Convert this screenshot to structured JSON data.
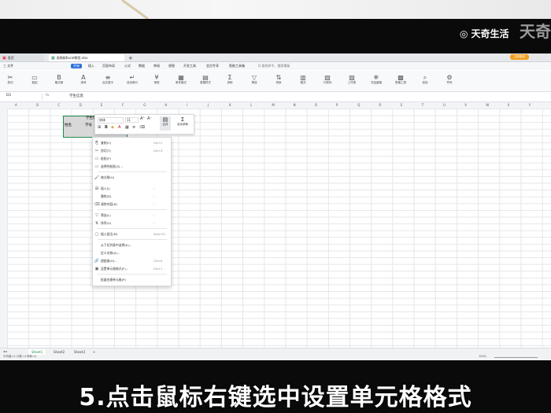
{
  "watermark": {
    "brand": "天奇生活",
    "corner": "天奇"
  },
  "caption": "5.点击鼠标右键选中设置单元格格式",
  "window": {
    "tabs": [
      {
        "label": "首页"
      },
      {
        "label": "表格制Excel教程.xlsx"
      }
    ],
    "new_tab": "+",
    "login": "立即登录"
  },
  "menubar": {
    "items": [
      "三 文件",
      "开始",
      "插入",
      "页面布局",
      "公式",
      "数据",
      "审阅",
      "视图",
      "开发工具",
      "会员专享",
      "智能工具箱"
    ],
    "search": "Q 查找命令、搜索模板"
  },
  "ribbon": {
    "buttons": [
      {
        "icon": "✂",
        "label": "剪切"
      },
      {
        "icon": "▭",
        "label": "粘贴"
      },
      {
        "icon": "B",
        "label": "格式刷"
      },
      {
        "icon": "A",
        "label": "宋体"
      },
      {
        "icon": "≡",
        "label": "合并居中"
      },
      {
        "icon": "↵",
        "label": "自动换行"
      },
      {
        "icon": "¥",
        "label": "常规"
      },
      {
        "icon": "▦",
        "label": "条件格式"
      },
      {
        "icon": "▤",
        "label": "表格样式"
      },
      {
        "icon": "Σ",
        "label": "求和"
      },
      {
        "icon": "▽",
        "label": "筛选"
      },
      {
        "icon": "⇅",
        "label": "排序"
      },
      {
        "icon": "▥",
        "label": "格式"
      },
      {
        "icon": "▧",
        "label": "行和列"
      },
      {
        "icon": "▨",
        "label": "工作表"
      },
      {
        "icon": "❄",
        "label": "冻结窗格"
      },
      {
        "icon": "▩",
        "label": "表格工具"
      },
      {
        "icon": "⌕",
        "label": "查找"
      },
      {
        "icon": "⚙",
        "label": "符号"
      }
    ]
  },
  "formula_bar": {
    "name_box": "D1",
    "fx": "fx",
    "value": "学生信息"
  },
  "columns": [
    "A",
    "B",
    "C",
    "D",
    "E",
    "F",
    "G",
    "H",
    "I",
    "J",
    "K",
    "L",
    "M",
    "N",
    "O",
    "P",
    "Q",
    "R",
    "S",
    "T",
    "U",
    "V",
    "W",
    "X",
    "Y"
  ],
  "cells": {
    "title": "学生信息",
    "name": "姓名",
    "id": "学号"
  },
  "mini_toolbar": {
    "font": "宋体",
    "size": "11",
    "merge": "合并",
    "autosum": "自动求和"
  },
  "context_menu": {
    "items": [
      {
        "icon": "⎘",
        "label": "复制(C)",
        "shortcut": "Ctrl+C"
      },
      {
        "icon": "✂",
        "label": "剪切(T)",
        "shortcut": "Ctrl+X"
      },
      {
        "icon": "▭",
        "label": "粘贴(P)",
        "shortcut": ""
      },
      {
        "icon": "▭",
        "label": "选择性粘贴(S)...",
        "shortcut": ""
      },
      {
        "icon": "🖌",
        "label": "格式刷(O)",
        "shortcut": ""
      },
      {
        "icon": "⊞",
        "label": "插入(I)",
        "shortcut": "›"
      },
      {
        "icon": "",
        "label": "删除(D)",
        "shortcut": "›"
      },
      {
        "icon": "⌫",
        "label": "清除内容(N)",
        "shortcut": "›"
      },
      {
        "icon": "▽",
        "label": "筛选(L)",
        "shortcut": "›"
      },
      {
        "icon": "⇅",
        "label": "排序(U)",
        "shortcut": "›"
      },
      {
        "icon": "▢",
        "label": "插入批注(M)",
        "shortcut": "Shift+F2"
      },
      {
        "icon": "",
        "label": "从下拉列表中选择(K)...",
        "shortcut": ""
      },
      {
        "icon": "",
        "label": "定义名称(A)...",
        "shortcut": ""
      },
      {
        "icon": "🔗",
        "label": "超链接(H)...",
        "shortcut": "Ctrl+K"
      },
      {
        "icon": "▣",
        "label": "设置单元格格式(F)...",
        "shortcut": "Ctrl+1"
      },
      {
        "icon": "",
        "label": "批量处理单元格(P)",
        "shortcut": ""
      }
    ]
  },
  "sheets": [
    "Sheet1",
    "Sheet2",
    "Sheet3",
    "+"
  ],
  "status": {
    "left": "平均值=0  计数=4  求和=0",
    "zoom": "100%"
  }
}
